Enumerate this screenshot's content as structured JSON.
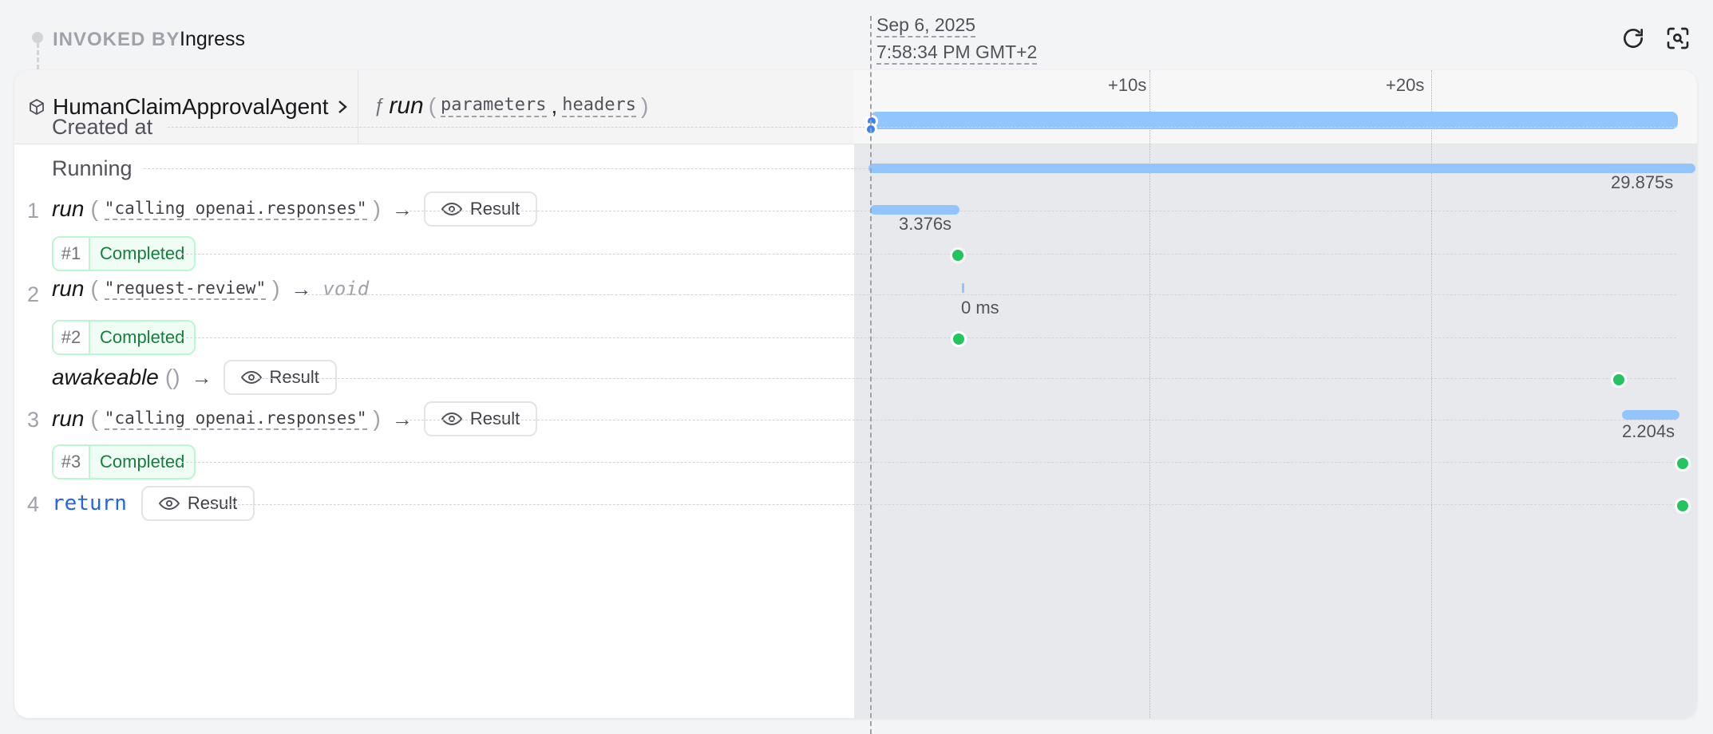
{
  "invoked": {
    "label": "INVOKED BY",
    "value": "Ingress"
  },
  "timestamp": {
    "date": "Sep 6, 2025",
    "time": "7:58:34 PM GMT+2"
  },
  "toolbar": {
    "refresh_icon": "refresh-icon",
    "zoom_icon": "zoom-search-icon"
  },
  "header": {
    "service_icon": "box-icon",
    "service": "HumanClaimApprovalAgent",
    "chevron": "›",
    "fn_icon": "ƒ",
    "fn_name": "run",
    "params": [
      "parameters",
      "headers"
    ]
  },
  "timeline": {
    "ticks": [
      "+10s",
      "+20s"
    ],
    "total_duration_s": 29.875
  },
  "rows": {
    "created": {
      "label": "Created at"
    },
    "running": {
      "label": "Running",
      "duration": "29.875s"
    },
    "step1": {
      "num": "1",
      "fn": "run",
      "arg": "\"calling openai.responses\"",
      "result": "Result",
      "duration": "3.376s",
      "duration_s": 3.376
    },
    "badge1": {
      "num": "#1",
      "status": "Completed"
    },
    "step2": {
      "num": "2",
      "fn": "run",
      "arg": "\"request-review\"",
      "ret": "void",
      "duration": "0 ms"
    },
    "badge2": {
      "num": "#2",
      "status": "Completed"
    },
    "awake": {
      "fn": "awakeable",
      "result": "Result"
    },
    "step3": {
      "num": "3",
      "fn": "run",
      "arg": "\"calling openai.responses\"",
      "result": "Result",
      "duration": "2.204s",
      "duration_s": 2.204
    },
    "badge3": {
      "num": "#3",
      "status": "Completed"
    },
    "step4": {
      "num": "4",
      "fn": "return",
      "result": "Result"
    }
  },
  "colors": {
    "bar": "#93c5fd",
    "completed": "#22c55e",
    "return": "#2563eb"
  }
}
